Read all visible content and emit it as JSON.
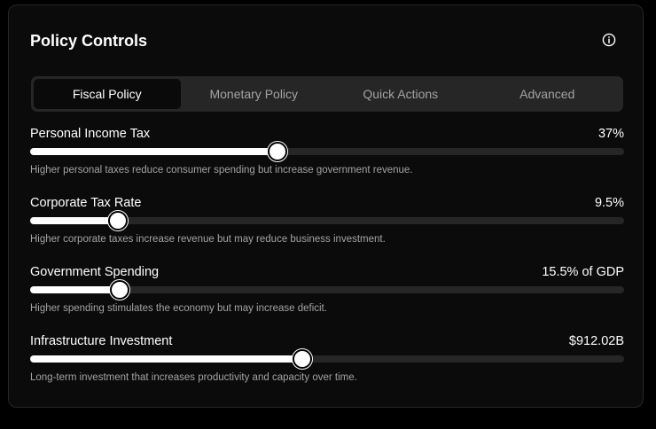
{
  "panel": {
    "title": "Policy Controls",
    "info_icon": "info-circle-icon"
  },
  "tabs": [
    {
      "label": "Fiscal Policy",
      "active": true
    },
    {
      "label": "Monetary Policy",
      "active": false
    },
    {
      "label": "Quick Actions",
      "active": false
    },
    {
      "label": "Advanced",
      "active": false
    }
  ],
  "controls": [
    {
      "label": "Personal Income Tax",
      "value": "37%",
      "level": 0.415,
      "description": "Higher personal taxes reduce consumer spending but increase government revenue."
    },
    {
      "label": "Corporate Tax Rate",
      "value": "9.5%",
      "level": 0.146,
      "description": "Higher corporate taxes increase revenue but may reduce business investment."
    },
    {
      "label": "Government Spending",
      "value": "15.5% of GDP",
      "level": 0.149,
      "description": "Higher spending stimulates the economy but may increase deficit."
    },
    {
      "label": "Infrastructure Investment",
      "value": "$912.02B",
      "level": 0.456,
      "description": "Long-term investment that increases productivity and capacity over time."
    }
  ]
}
